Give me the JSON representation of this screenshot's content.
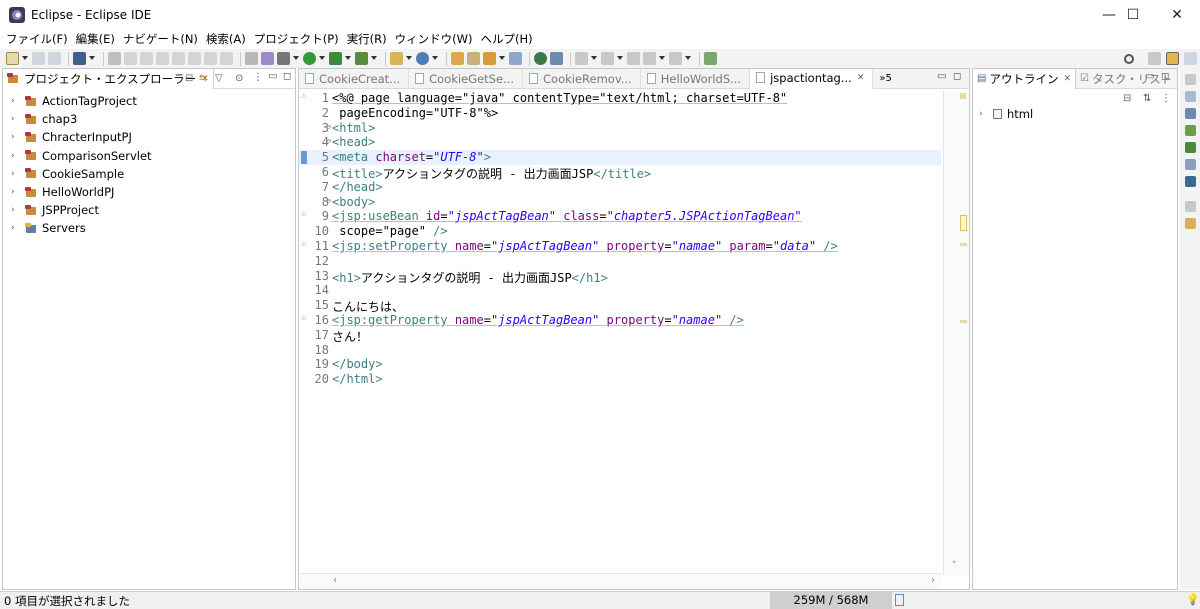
{
  "window": {
    "title": "Eclipse - Eclipse IDE",
    "minimize": "—",
    "maximize": "☐",
    "close": "✕"
  },
  "menu": [
    "ファイル(F)",
    "編集(E)",
    "ナビゲート(N)",
    "検索(A)",
    "プロジェクト(P)",
    "実行(R)",
    "ウィンドウ(W)",
    "ヘルプ(H)"
  ],
  "explorer": {
    "tab_label": "プロジェクト・エクスプローラー",
    "items": [
      {
        "label": "ActionTagProject",
        "icon": "project-icon"
      },
      {
        "label": "chap3",
        "icon": "project-icon"
      },
      {
        "label": "ChracterInputPJ",
        "icon": "project-icon"
      },
      {
        "label": "ComparisonServlet",
        "icon": "project-icon"
      },
      {
        "label": "CookieSample",
        "icon": "project-icon"
      },
      {
        "label": "HelloWorldPJ",
        "icon": "project-icon"
      },
      {
        "label": "JSPProject",
        "icon": "project-icon"
      },
      {
        "label": "Servers",
        "icon": "servers-folder-icon"
      }
    ]
  },
  "editor": {
    "tabs": [
      {
        "label": "CookieCreat...",
        "active": false
      },
      {
        "label": "CookieGetSe...",
        "active": false
      },
      {
        "label": "CookieRemov...",
        "active": false
      },
      {
        "label": "HelloWorldS...",
        "active": false
      },
      {
        "label": "jspactiontag...",
        "active": true
      }
    ],
    "overflow_label": "»5",
    "lines": [
      {
        "n": "1",
        "warn": true,
        "text": "<%@ page language=\"java\" contentType=\"text/html; charset=UTF-8\""
      },
      {
        "n": "2",
        "text": " pageEncoding=\"UTF-8\"%>"
      },
      {
        "n": "3",
        "fold": true,
        "text": "<html>"
      },
      {
        "n": "4",
        "fold": true,
        "text": "<head>"
      },
      {
        "n": "5",
        "current": true,
        "text": "<meta charset=\"UTF-8\">"
      },
      {
        "n": "6",
        "text": "<title>アクションタグの説明 - 出力画面JSP</title>"
      },
      {
        "n": "7",
        "text": "</head>"
      },
      {
        "n": "8",
        "fold": true,
        "text": "<body>"
      },
      {
        "n": "9",
        "warn": true,
        "text": "<jsp:useBean id=\"jspActTagBean\" class=\"chapter5.JSPActionTagBean\""
      },
      {
        "n": "10",
        "text": " scope=\"page\" />"
      },
      {
        "n": "11",
        "warn": true,
        "text": "<jsp:setProperty name=\"jspActTagBean\" property=\"namae\" param=\"data\" />"
      },
      {
        "n": "12",
        "text": ""
      },
      {
        "n": "13",
        "text": "<h1>アクションタグの説明 - 出力画面JSP</h1>"
      },
      {
        "n": "14",
        "text": ""
      },
      {
        "n": "15",
        "text": "こんにちは、"
      },
      {
        "n": "16",
        "warn": true,
        "text": "<jsp:getProperty name=\"jspActTagBean\" property=\"namae\" />"
      },
      {
        "n": "17",
        "text": "さん！"
      },
      {
        "n": "18",
        "text": ""
      },
      {
        "n": "19",
        "text": "</body>"
      },
      {
        "n": "20",
        "text": "</html>"
      }
    ]
  },
  "outline": {
    "tab_label": "アウトライン",
    "tasks_tab_label": "タスク・リスト",
    "items": [
      {
        "label": "html"
      }
    ]
  },
  "status": {
    "message": "0 項目が選択されました",
    "heap": "259M / 568M"
  },
  "colors": {
    "tag": "#3f7f7f",
    "attr": "#7f007f",
    "value": "#2a00ff",
    "current_line": "#e8f2fe"
  }
}
